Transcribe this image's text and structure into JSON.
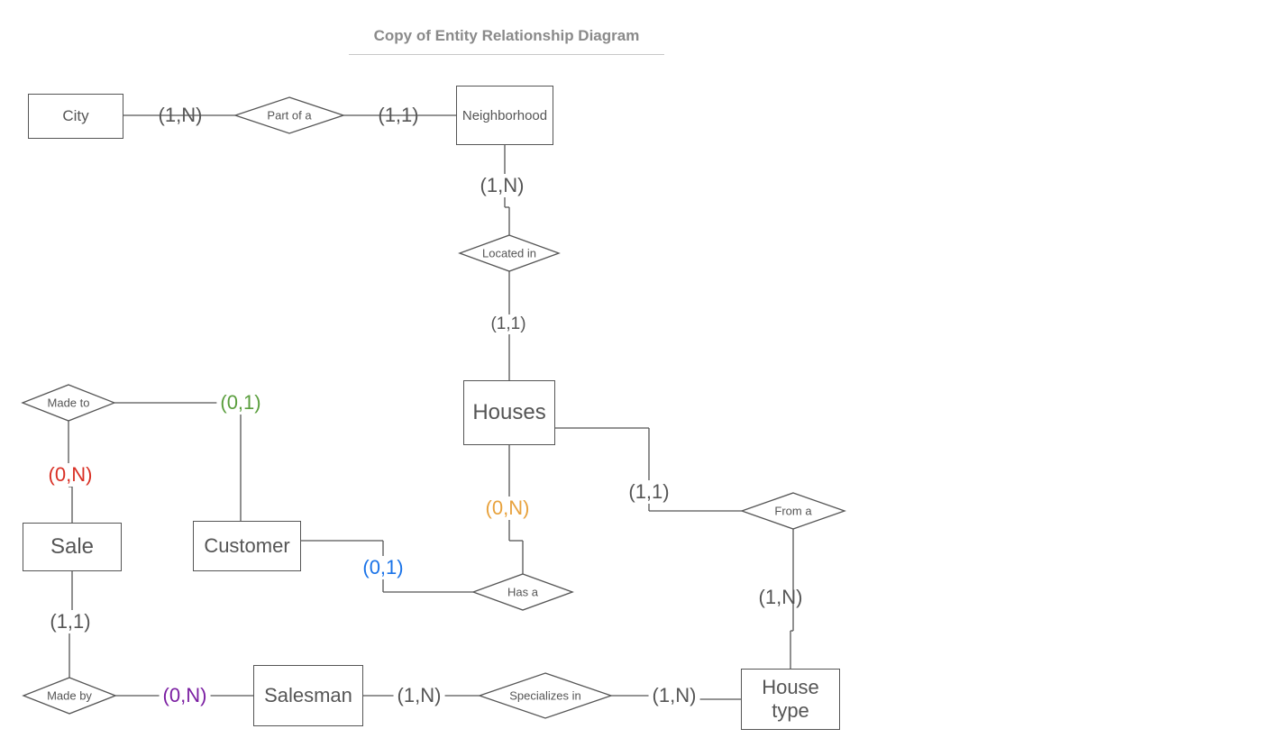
{
  "title": "Copy of  Entity Relationship Diagram",
  "entities": {
    "city": "City",
    "neighborhood": "Neighborhood",
    "houses": "Houses",
    "sale": "Sale",
    "customer": "Customer",
    "salesman": "Salesman",
    "house_type": "House type"
  },
  "relationships": {
    "part_of_a": "Part of a",
    "located_in": "Located in",
    "made_to": "Made to",
    "has_a": "Has a",
    "from_a": "From a",
    "made_by": "Made by",
    "specializes_in": "Specializes in"
  },
  "cardinalities": {
    "city_partof": "(1,N)",
    "neighborhood_partof": "(1,1)",
    "neighborhood_located": "(1,N)",
    "houses_located": "(1,1)",
    "madeto_customer": "(0,1)",
    "madeto_sale": "(0,N)",
    "sale_madeby": "(1,1)",
    "madeby_salesman": "(0,N)",
    "customer_hasa": "(0,1)",
    "houses_hasa": "(0,N)",
    "houses_froma": "(1,1)",
    "froma_housetype": "(1,N)",
    "salesman_spec": "(1,N)",
    "housetype_spec": "(1,N)"
  },
  "colors": {
    "default": "#555555",
    "green": "#5a9e3d",
    "red": "#d93025",
    "orange": "#e8a23d",
    "blue": "#1a73e8",
    "purple": "#7b1fa2"
  }
}
